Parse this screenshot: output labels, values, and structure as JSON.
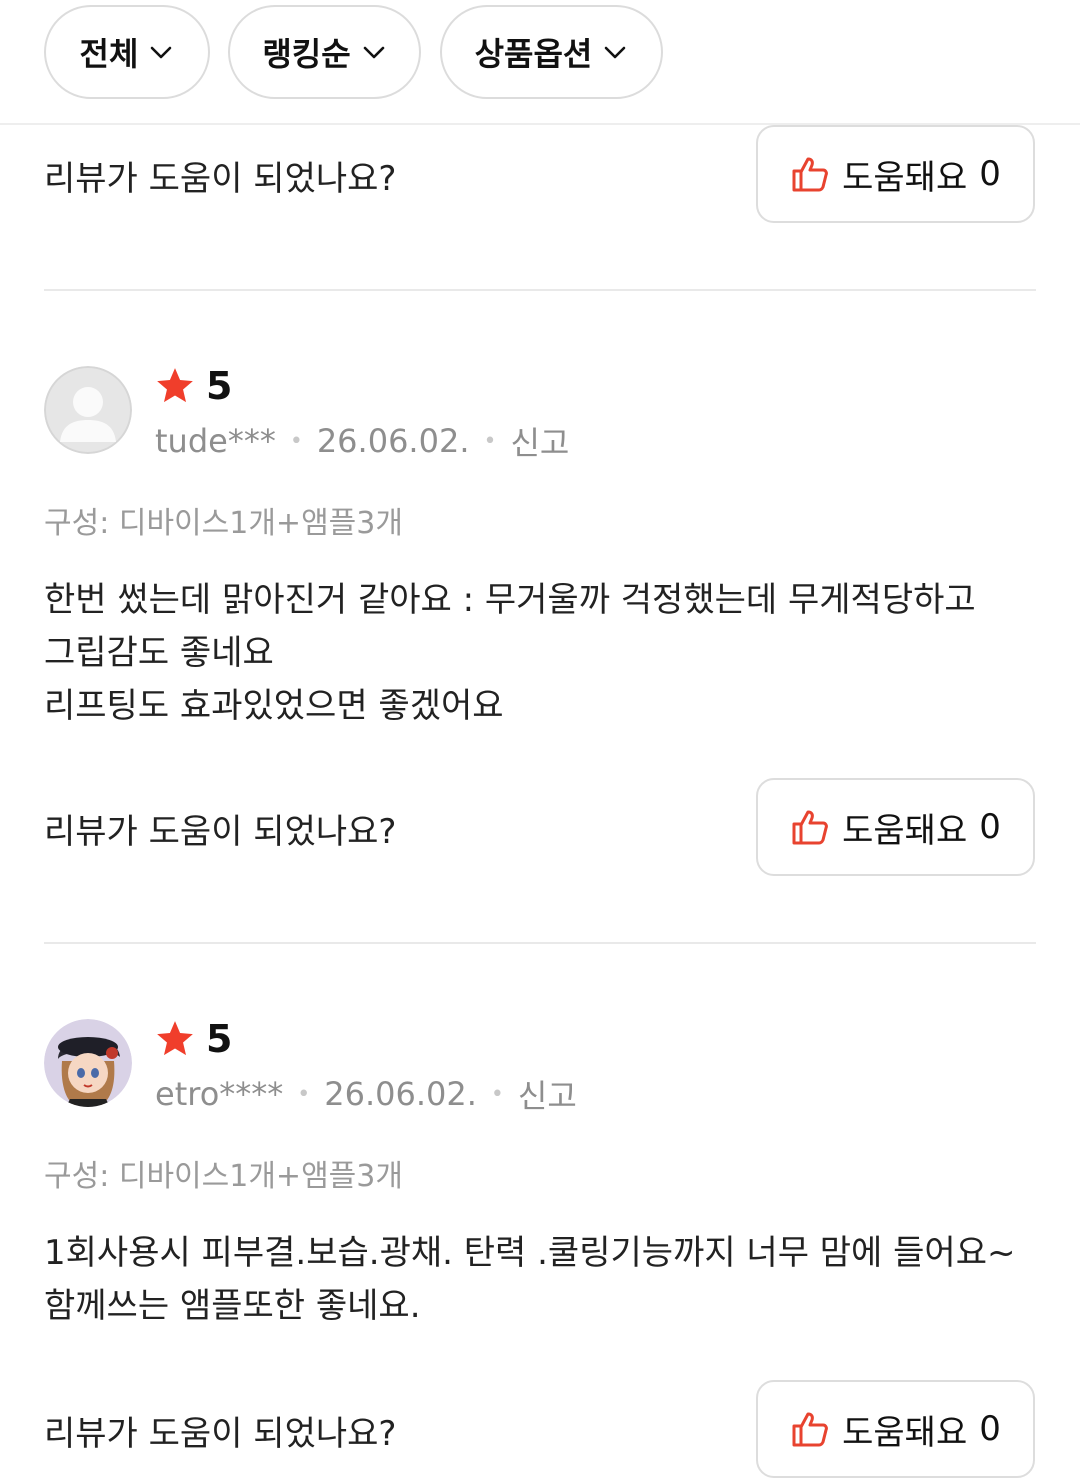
{
  "filters": [
    {
      "label": "전체"
    },
    {
      "label": "랭킹순"
    },
    {
      "label": "상품옵션"
    }
  ],
  "helpful": {
    "question": "리뷰가 도움이 되었나요?",
    "button_label": "도움돼요",
    "count": "0"
  },
  "reviews": [
    {
      "rating": "5",
      "user": "tude***",
      "date": "26.06.02.",
      "report": "신고",
      "option": "구성: 디바이스1개+앰플3개",
      "lines": [
        "한번 썼는데 맑아진거 같아요 : 무거울까 걱정했는데 무게적당하고",
        "그립감도 좋네요",
        "리프팅도 효과있었으면 좋겠어요"
      ],
      "helpful_count": "0"
    },
    {
      "rating": "5",
      "user": "etro****",
      "date": "26.06.02.",
      "report": "신고",
      "option": "구성: 디바이스1개+앰플3개",
      "lines": [
        "1회사용시 피부결.보습.광채. 탄력 .쿨링기능까지 너무 맘에 들어요~",
        "함께쓰는 앰플또한 좋네요."
      ],
      "helpful_count": "0"
    }
  ],
  "colors": {
    "star": "#f03e2b",
    "thumb": "#e8432f",
    "text": "#222222",
    "muted": "#8e8e8e"
  },
  "icons": {
    "chevron": "chevron-down-icon",
    "thumb": "thumbs-up-icon",
    "star": "star-icon"
  }
}
